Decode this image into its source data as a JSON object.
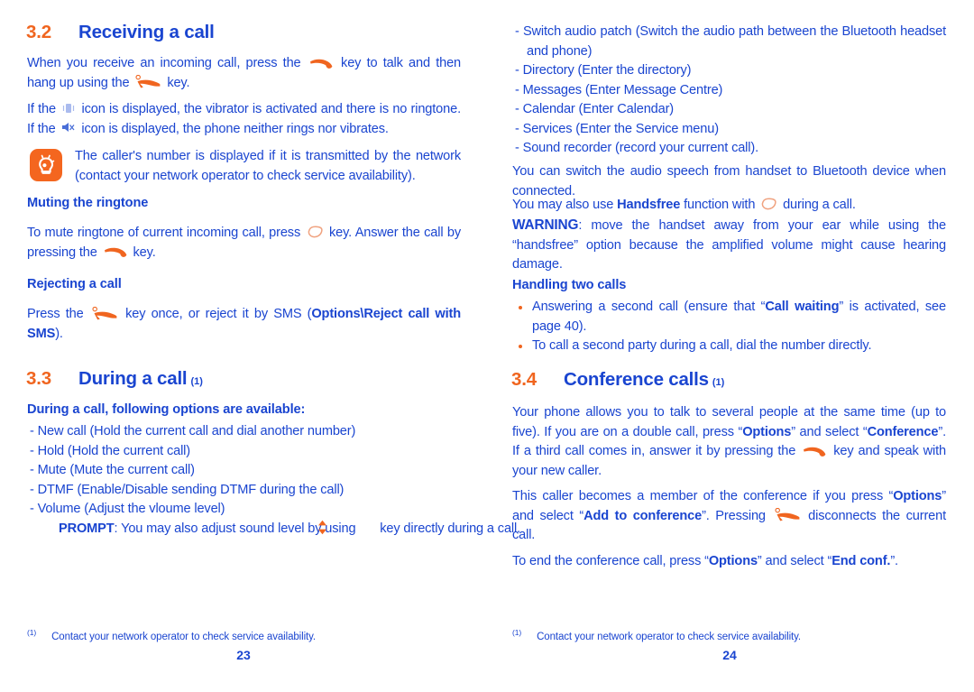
{
  "document": {
    "type": "mobile-phone-user-manual-spread",
    "accent_orange": "#f0651f",
    "accent_blue": "#1a45d0"
  },
  "left_page": {
    "page_number": "23",
    "section_32": {
      "number": "3.2",
      "title": "Receiving a call",
      "paragraph_1_part1": "When you receive an incoming call, press the",
      "paragraph_1_part2": "key to talk and then hang up using the",
      "paragraph_1_part3": "key.",
      "paragraph_2_part1": "If the",
      "paragraph_2_part2": "icon is displayed, the vibrator is activated and there is no ringtone. If the",
      "paragraph_2_part3": "icon is displayed, the phone neither rings nor vibrates.",
      "note": "The caller's number is displayed if it is transmitted by the network (contact your network operator to check service availability).",
      "note_icon": "lightbulb-icon",
      "muting_heading": "Muting the ringtone",
      "muting_part1": "To mute ringtone of current incoming call, press",
      "muting_part2": "key. Answer the call by pressing the",
      "muting_part3": "key.",
      "rejecting_heading": "Rejecting a call",
      "rejecting_part1": "Press the",
      "rejecting_part2": "key once, or reject it by SMS (",
      "rejecting_bold": "Options\\Reject call with SMS",
      "rejecting_part3": ")."
    },
    "section_33": {
      "number": "3.3",
      "title": "During a call",
      "footnote_mark": "(1)",
      "options_heading": "During a call, following options are available:",
      "options": [
        "- New call (Hold the current call and dial another number)",
        "- Hold (Hold the current call)",
        "- Mute (Mute the current call)",
        "- DTMF (Enable/Disable sending DTMF during the call)",
        "- Volume (Adjust the vloume level)"
      ],
      "prompt_label": "PROMPT",
      "prompt_part1": ": You may also adjust sound level by using",
      "prompt_part2": "key directly during a call."
    },
    "footnote": {
      "mark": "(1)",
      "text": "Contact your network operator to check service availability."
    }
  },
  "right_page": {
    "page_number": "24",
    "options_continued": [
      "- Switch audio patch (Switch the audio path between the Bluetooth headset and phone)",
      "- Directory (Enter the directory)",
      "- Messages (Enter Message Centre)",
      "- Calendar (Enter Calendar)",
      "- Services (Enter the Service menu)",
      "- Sound recorder (record your current call)."
    ],
    "paragraph_switch": "You can switch the audio speech from handset to Bluetooth device when connected.",
    "handsfree_part1": "You may also use",
    "handsfree_bold": "Handsfree",
    "handsfree_part2": "function with",
    "handsfree_part3": "during a call.",
    "warning_label": "WARNING",
    "warning_text": ": move the handset away from your ear while using the “handsfree” option because the amplified volume might cause hearing damage.",
    "handling_heading": "Handling two calls",
    "handling_bullet_1_part1": "Answering a second call (ensure that “",
    "handling_bullet_1_bold": "Call waiting",
    "handling_bullet_1_part2": "” is activated, see page 40).",
    "handling_bullet_2": "To call a second party during a call, dial the number directly.",
    "section_34": {
      "number": "3.4",
      "title": "Conference calls",
      "footnote_mark": "(1)",
      "para1_part1": "Your phone allows you to talk to several people at the same time (up to five). If you are on a double call, press “",
      "para1_bold1": "Options",
      "para1_part2": "” and select “",
      "para1_bold2": "Conference",
      "para1_part3": "”. If a third call comes in, answer it by pressing the",
      "para1_part4": "key and speak with your new caller.",
      "para2_part1": "This caller becomes a member of the conference if you press “",
      "para2_bold1": "Options",
      "para2_part2": "” and select “",
      "para2_bold2": "Add to conference",
      "para2_part3": "”. Pressing",
      "para2_part4": "disconnects the current call.",
      "para3_part1": "To end the conference call, press “",
      "para3_bold1": "Options",
      "para3_part2": "” and select “",
      "para3_bold2": "End conf.",
      "para3_part3": "”."
    },
    "footnote": {
      "mark": "(1)",
      "text": "Contact your network operator to check service availability."
    }
  }
}
